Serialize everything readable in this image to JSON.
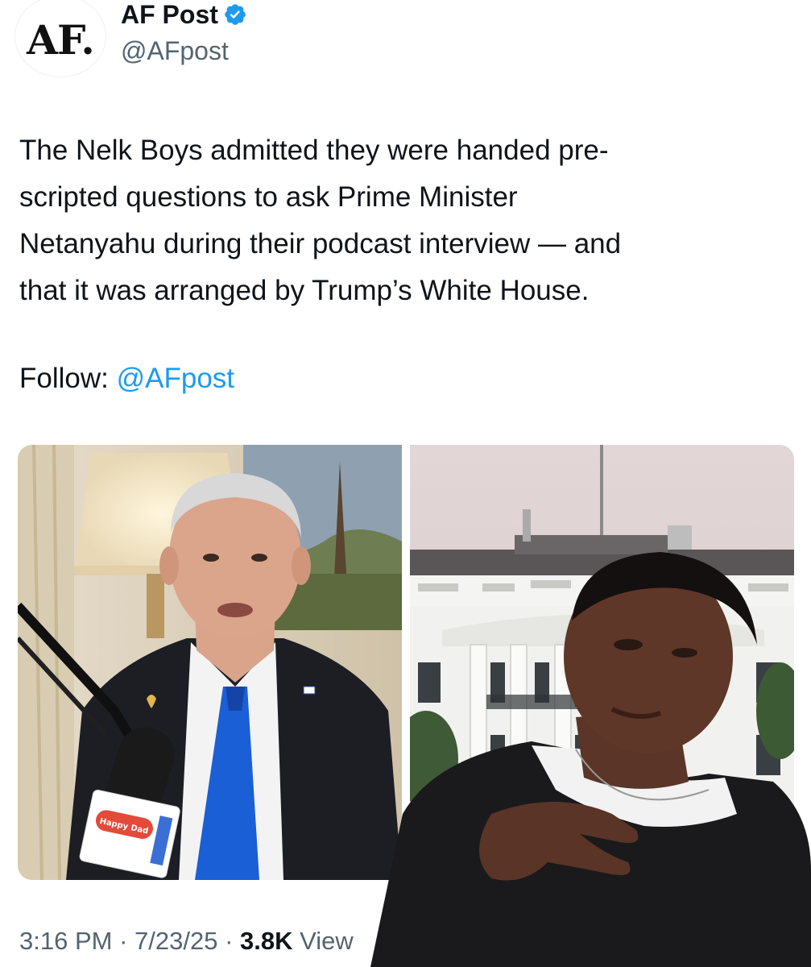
{
  "account": {
    "avatar_text": "AF.",
    "display_name": "AF Post",
    "handle": "@AFpost",
    "verified": true,
    "verified_color": "#1d9bf0"
  },
  "tweet": {
    "text_lines": [
      "The Nelk Boys admitted they were handed pre-",
      "scripted questions to ask Prime Minister",
      "Netanyahu during their podcast interview — and",
      "that it was arranged by Trump’s White House."
    ],
    "follow_label": "Follow:",
    "follow_mention": "@AFpost",
    "mention_color": "#1d9bf0"
  },
  "media": {
    "left_image": "photo-man-at-podcast-microphone",
    "mic_flag_text": "Happy Dad",
    "right_image": "photo-white-house",
    "overlay_image": "meme-cutout-person-gesturing"
  },
  "meta": {
    "time": "3:16 PM",
    "separator": "·",
    "date": "7/23/25",
    "views_count": "3.8K",
    "views_label": "View"
  }
}
